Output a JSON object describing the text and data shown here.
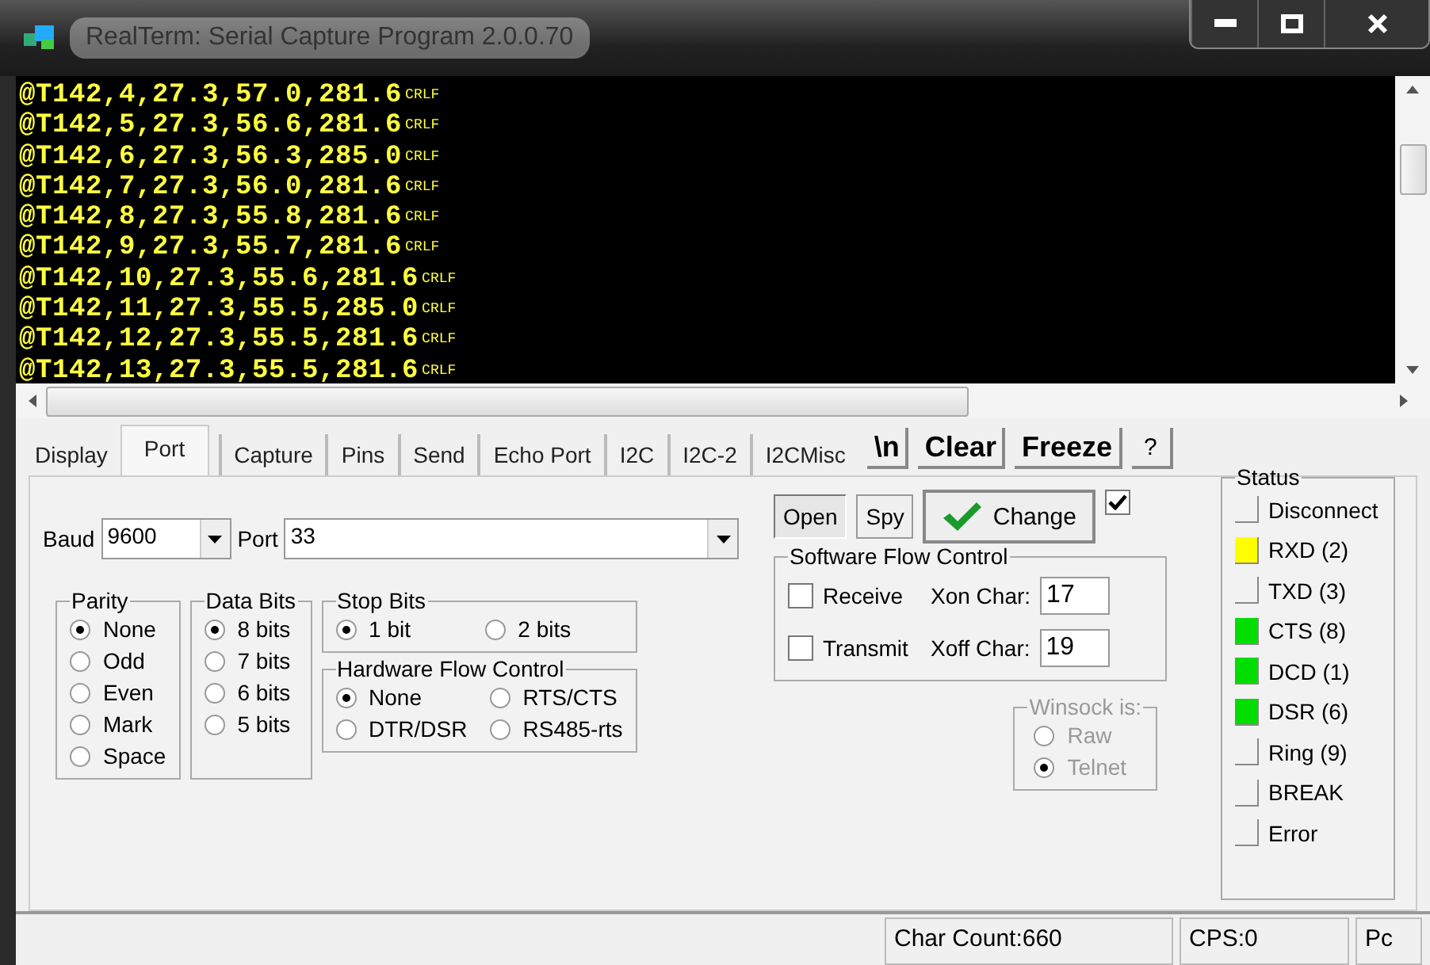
{
  "window": {
    "title": "RealTerm: Serial Capture Program 2.0.0.70"
  },
  "terminal": {
    "lines": [
      {
        "text": "@T142,4,27.3,57.0,281.6",
        "end": "CRLF"
      },
      {
        "text": "@T142,5,27.3,56.6,281.6",
        "end": "CRLF"
      },
      {
        "text": "@T142,6,27.3,56.3,285.0",
        "end": "CRLF"
      },
      {
        "text": "@T142,7,27.3,56.0,281.6",
        "end": "CRLF"
      },
      {
        "text": "@T142,8,27.3,55.8,281.6",
        "end": "CRLF"
      },
      {
        "text": "@T142,9,27.3,55.7,281.6",
        "end": "CRLF"
      },
      {
        "text": "@T142,10,27.3,55.6,281.6",
        "end": "CRLF"
      },
      {
        "text": "@T142,11,27.3,55.5,285.0",
        "end": "CRLF"
      },
      {
        "text": "@T142,12,27.3,55.5,281.6",
        "end": "CRLF"
      },
      {
        "text": "@T142,13,27.3,55.5,281.6",
        "end": "CRLF"
      }
    ]
  },
  "tabs": [
    {
      "label": "Display",
      "selected": false
    },
    {
      "label": "Port",
      "selected": true
    },
    {
      "label": "Capture",
      "selected": false
    },
    {
      "label": "Pins",
      "selected": false
    },
    {
      "label": "Send",
      "selected": false
    },
    {
      "label": "Echo Port",
      "selected": false
    },
    {
      "label": "I2C",
      "selected": false
    },
    {
      "label": "I2C-2",
      "selected": false
    },
    {
      "label": "I2CMisc",
      "selected": false
    }
  ],
  "toolbar_buttons": [
    "\\n",
    "Clear",
    "Freeze",
    "?"
  ],
  "port": {
    "baud": {
      "label": "Baud",
      "value": "9600"
    },
    "port": {
      "label": "Port",
      "value": "33"
    },
    "groups": [
      {
        "title": "Parity",
        "disabled": false,
        "options": [
          {
            "label": "None",
            "selected": true
          },
          {
            "label": "Odd",
            "selected": false
          },
          {
            "label": "Even",
            "selected": false
          },
          {
            "label": "Mark",
            "selected": false
          },
          {
            "label": "Space",
            "selected": false
          }
        ]
      },
      {
        "title": "Data Bits",
        "disabled": false,
        "options": [
          {
            "label": "8 bits",
            "selected": true
          },
          {
            "label": "7 bits",
            "selected": false
          },
          {
            "label": "6 bits",
            "selected": false
          },
          {
            "label": "5 bits",
            "selected": false
          }
        ]
      },
      {
        "title": "Stop Bits",
        "disabled": false,
        "options": [
          {
            "label": "1 bit",
            "selected": true
          },
          {
            "label": "2 bits",
            "selected": false
          }
        ]
      },
      {
        "title": "Hardware Flow Control",
        "disabled": false,
        "options": [
          {
            "label": "None",
            "selected": true
          },
          {
            "label": "RTS/CTS",
            "selected": false
          },
          {
            "label": "DTR/DSR",
            "selected": false
          },
          {
            "label": "RS485-rts",
            "selected": false
          }
        ]
      },
      {
        "title": "Winsock is:",
        "disabled": true,
        "options": [
          {
            "label": "Raw",
            "selected": false
          },
          {
            "label": "Telnet",
            "selected": true
          }
        ]
      }
    ],
    "buttons": [
      {
        "label": "Open",
        "pressed": true
      },
      {
        "label": "Spy",
        "pressed": false
      }
    ],
    "change": {
      "label": "Change",
      "checked": true
    },
    "software_flow": {
      "title": "Software Flow Control",
      "rows": [
        {
          "label": "Receive",
          "checked": false,
          "char_label": "Xon Char:",
          "value": "17"
        },
        {
          "label": "Transmit",
          "checked": false,
          "char_label": "Xoff Char:",
          "value": "19"
        }
      ]
    },
    "status": {
      "title": "Status",
      "items": [
        {
          "label": "Disconnect",
          "lit": false
        },
        {
          "label": "RXD (2)",
          "lit": true,
          "color": "#ffff00"
        },
        {
          "label": "TXD (3)",
          "lit": false
        },
        {
          "label": "CTS (8)",
          "lit": true,
          "color": "#00dd00"
        },
        {
          "label": "DCD (1)",
          "lit": true,
          "color": "#00dd00"
        },
        {
          "label": "DSR (6)",
          "lit": true,
          "color": "#00dd00"
        },
        {
          "label": "Ring (9)",
          "lit": false
        },
        {
          "label": "BREAK",
          "lit": false
        },
        {
          "label": "Error",
          "lit": false
        }
      ]
    }
  },
  "status_bar": [
    "Char Count:660",
    "CPS:0",
    "Pc"
  ]
}
